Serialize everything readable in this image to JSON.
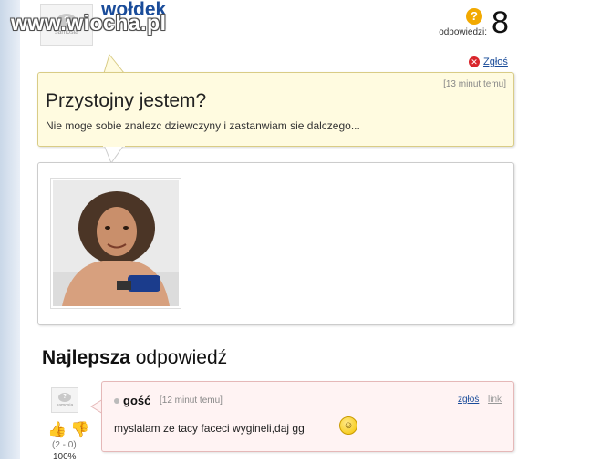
{
  "watermark": "www.wiocha.pl",
  "question": {
    "author": "wołdek",
    "avatar_text": "samosia",
    "answers_label": "odpowiedzi:",
    "answers_count": "8",
    "report_label": "Zgłoś",
    "time": "[13 minut temu]",
    "title": "Przystojny jestem?",
    "body": "Nie moge sobie znalezc dziewczyny i zastanwiam sie dalczego..."
  },
  "best_answer": {
    "heading_bold": "Najlepsza",
    "heading_rest": " odpowiedź",
    "avatar_text": "samosia",
    "user": "gość",
    "time": "[12 minut temu]",
    "report_label": "zgłoś",
    "link_label": "link",
    "text": "myslalam ze tacy faceci wygineli,daj gg",
    "votes": "(2 - 0)",
    "vote_pct": "100%"
  },
  "colors": {
    "link": "#1a4c9a",
    "question_bg": "#fffbe0",
    "answer_bg": "#fff3f3",
    "answers_icon": "#f2a900",
    "report_icon": "#d9262c"
  }
}
